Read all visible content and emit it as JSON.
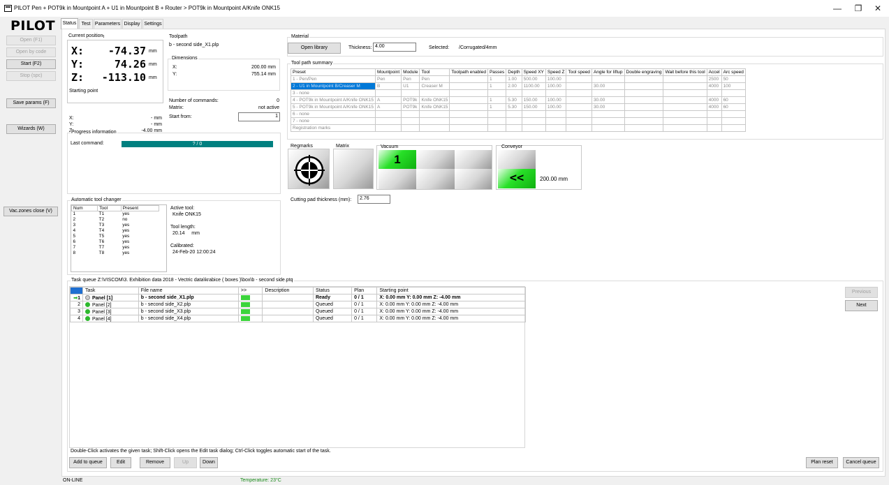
{
  "window": {
    "title": "PILOT  Pen + POT9k in Mountpoint A + U1 in Mountpoint B + Router > POT9k in Mountpoint A/Knife ONK15",
    "minimize": "—",
    "maximize": "❐",
    "close": "✕"
  },
  "logo": "PILOT",
  "left_buttons": {
    "open": "Open (F1)",
    "open_by_code": "Open by code",
    "start": "Start (F2)",
    "stop": "Stop (spc)",
    "save_params": "Save params (F)",
    "wizards": "Wizards (W)",
    "vac_zones": "Vac.zones close (V)"
  },
  "tabs": [
    "Status",
    "Test",
    "Parameters",
    "Display",
    "Settings"
  ],
  "current_position": {
    "label": "Current position",
    "x_label": "X:",
    "x_value": "-74.37",
    "y_label": "Y:",
    "y_value": "74.26",
    "z_label": "Z:",
    "z_value": "-113.10",
    "unit": "mm"
  },
  "starting_point": {
    "label": "Starting point",
    "x_label": "X:",
    "x_value": "- mm",
    "y_label": "Y:",
    "y_value": "- mm",
    "z_label": "Z:",
    "z_value": "-4.00 mm"
  },
  "toolpath": {
    "label": "Toolpath",
    "file": "b - second side_X1.plp",
    "dimensions_label": "Dimensions",
    "x_label": "X:",
    "x_value": "200.00 mm",
    "y_label": "Y:",
    "y_value": "755.14 mm",
    "num_commands_label": "Number of commands:",
    "num_commands": "0",
    "matrix_label": "Matrix:",
    "matrix_value": "not active",
    "start_from_label": "Start from:",
    "start_from": "1"
  },
  "progress": {
    "label": "Progress information",
    "last_command_label": "Last command:",
    "bar_text": "? / 0",
    "fraction": 1.0
  },
  "material": {
    "label": "Material",
    "open_library": "Open library",
    "thickness_label": "Thickness:",
    "thickness": "4.00",
    "selected_label": "Selected:",
    "selected": "/Corrugated/4mm"
  },
  "tool_path_summary": {
    "label": "Tool path summary",
    "headers": [
      "Preset",
      "Mountpoint",
      "Module",
      "Tool",
      "Toolpath enabled",
      "Passes",
      "Depth",
      "Speed XY",
      "Speed Z",
      "Tool speed",
      "Angle for liftup",
      "Double engraving",
      "Wait before this tool",
      "Accel",
      "Arc speed"
    ],
    "rows": [
      [
        "1 - Pen/Pen",
        "Pen",
        "Pen",
        "Pen",
        "",
        "1",
        "1.00",
        "500.00",
        "100.00",
        "",
        "",
        "",
        "",
        "2500",
        "50"
      ],
      [
        "2 - U1 in Mountpoint B/Creaser M",
        "B",
        "U1",
        "Creaser M",
        "",
        "1",
        "2.00",
        "1100.00",
        "100.00",
        "",
        "30.00",
        "",
        "",
        "4000",
        "100"
      ],
      [
        "3 - none",
        "",
        "",
        "",
        "",
        "",
        "",
        "",
        "",
        "",
        "",
        "",
        "",
        "",
        ""
      ],
      [
        "4 - POT9k in Mountpoint A/Knife ONK15",
        "A",
        "POT9k",
        "Knife ONK15",
        "",
        "1",
        "5.30",
        "150.00",
        "100.00",
        "",
        "30.00",
        "",
        "",
        "4000",
        "60"
      ],
      [
        "5 - POT9k in Mountpoint A/Knife ONK15",
        "A",
        "POT9k",
        "Knife ONK15",
        "",
        "1",
        "5.30",
        "150.00",
        "100.00",
        "",
        "30.00",
        "",
        "",
        "4000",
        "60"
      ],
      [
        "6 - none",
        "",
        "",
        "",
        "",
        "",
        "",
        "",
        "",
        "",
        "",
        "",
        "",
        "",
        ""
      ],
      [
        "7 - none",
        "",
        "",
        "",
        "",
        "",
        "",
        "",
        "",
        "",
        "",
        "",
        "",
        "",
        ""
      ],
      [
        "Registration marks",
        "",
        "",
        "",
        "",
        "",
        "",
        "",
        "",
        "",
        "",
        "",
        "",
        "",
        ""
      ]
    ]
  },
  "panels": {
    "regmarks": "Regmarks",
    "matrix": "Matrix",
    "vacuum": "Vacuum",
    "vacuum_zone": "1",
    "conveyor": "Conveyor",
    "conveyor_arrow": "<<",
    "conveyor_value": "200.00 mm",
    "cutting_pad_label": "Cutting pad thickness (mm):",
    "cutting_pad_value": "2.76"
  },
  "atc": {
    "label": "Automatic tool changer",
    "headers": [
      "Num",
      "Tool",
      "Present"
    ],
    "rows": [
      [
        "1",
        "T1",
        "yes"
      ],
      [
        "2",
        "T2",
        "no"
      ],
      [
        "3",
        "T3",
        "yes"
      ],
      [
        "4",
        "T4",
        "yes"
      ],
      [
        "5",
        "T5",
        "yes"
      ],
      [
        "6",
        "T6",
        "yes"
      ],
      [
        "7",
        "T7",
        "yes"
      ],
      [
        "8",
        "T8",
        "yes"
      ]
    ],
    "active_tool_label": "Active tool:",
    "active_tool": "Knife ONK15",
    "tool_length_label": "Tool length:",
    "tool_length": "20.14     mm",
    "calibrated_label": "Calibrated:",
    "calibrated": "24-Feb-20 12:00:24"
  },
  "task_queue": {
    "label": "Task queue Z:\\VISCOM\\3. Exhibition data 2018 - Vectric data\\krabice ( boxes )\\box\\b - second side.ptq",
    "headers": [
      "",
      "Task",
      "File name",
      ">>",
      "Description",
      "Status",
      "Plan",
      "Starting point"
    ],
    "rows": [
      [
        "1",
        "Panel [1]",
        "b - second side_X1.plp",
        "",
        "",
        "Ready",
        "0 / 1",
        "X: 0.00 mm Y: 0.00 mm Z: -4.00 mm"
      ],
      [
        "2",
        "Panel [2]",
        "b - second side_X2.plp",
        "",
        "",
        "Queued",
        "0 / 1",
        "X: 0.00 mm Y: 0.00 mm Z: -4.00 mm"
      ],
      [
        "3",
        "Panel [3]",
        "b - second side_X3.plp",
        "",
        "",
        "Queued",
        "0 / 1",
        "X: 0.00 mm Y: 0.00 mm Z: -4.00 mm"
      ],
      [
        "4",
        "Panel [4]",
        "b - second side_X4.plp",
        "",
        "",
        "Queued",
        "0 / 1",
        "X: 0.00 mm Y: 0.00 mm Z: -4.00 mm"
      ]
    ],
    "help": "Double-Click activates the given task; Shift-Click opens the Edit task dialog; Ctrl-Click toggles automatic start of the task.",
    "buttons": {
      "add": "Add to queue",
      "edit": "Edit",
      "remove": "Remove",
      "up": "Up",
      "down": "Down",
      "plan_reset": "Plan reset",
      "cancel_queue": "Cancel queue",
      "previous": "Previous",
      "next": "Next"
    }
  },
  "status": {
    "online": "ON-LINE",
    "temperature": "Temperature: 23°C",
    "temperature_color": "#1a8a1a"
  }
}
